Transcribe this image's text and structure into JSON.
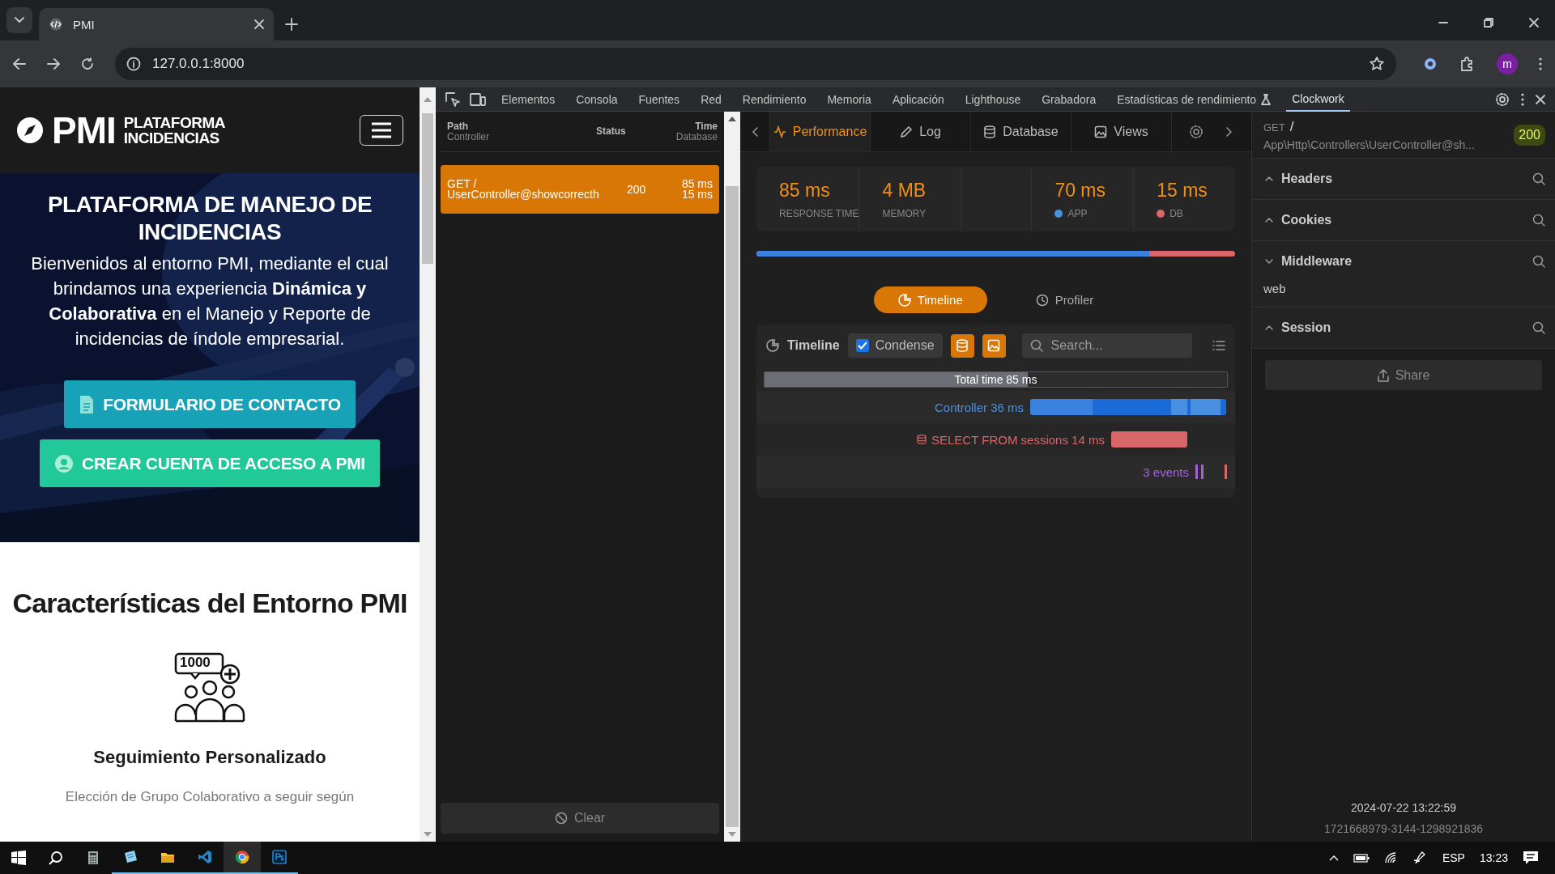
{
  "browser": {
    "tab_title": "PMI",
    "address": "127.0.0.1:8000",
    "profile_initial": "m"
  },
  "page": {
    "logo_mark": "PMI",
    "logo_lines": [
      "PLATAFORMA",
      "INCIDENCIAS"
    ],
    "hero_title": "PLATAFORMA DE MANEJO DE INCIDENCIAS",
    "hero_text": "Bienvenidos al entorno PMI, mediante el cual brindamos una experiencia **Dinámica y Colaborativa** en el Manejo y Reporte de incidencias de índole empresarial.",
    "buttons": [
      {
        "label": "FORMULARIO DE CONTACTO",
        "kind": "contact"
      },
      {
        "label": "CREAR CUENTA DE ACCESO A PMI",
        "kind": "account"
      }
    ],
    "section_title": "Características del Entorno PMI",
    "feature": {
      "badge": "1000",
      "title": "Seguimiento Personalizado",
      "text": "Elección de Grupo Colaborativo a seguir según"
    }
  },
  "devtools": {
    "tabs": [
      {
        "label": "Elementos",
        "selected": false
      },
      {
        "label": "Consola",
        "selected": false
      },
      {
        "label": "Fuentes",
        "selected": false
      },
      {
        "label": "Red",
        "selected": false
      },
      {
        "label": "Rendimiento",
        "selected": false
      },
      {
        "label": "Memoria",
        "selected": false
      },
      {
        "label": "Aplicación",
        "selected": false
      },
      {
        "label": "Lighthouse",
        "selected": false
      },
      {
        "label": "Grabadora",
        "selected": false
      },
      {
        "label": "Estadísticas de rendimiento",
        "selected": false
      },
      {
        "label": "Clockwork",
        "selected": true
      }
    ]
  },
  "requests": {
    "columns": [
      {
        "label": "Path",
        "sub": "Controller"
      },
      {
        "label": "Status"
      },
      {
        "label": "Time",
        "sub": "Database"
      }
    ],
    "rows": [
      {
        "path": "GET /",
        "controller": "UserController@showcorrecth",
        "status": "200",
        "time": "85 ms",
        "database": "15 ms",
        "selected": true
      }
    ],
    "clear": "Clear"
  },
  "panel": {
    "tabs": [
      {
        "label": "Performance",
        "kind": "performance",
        "selected": true
      },
      {
        "label": "Log",
        "kind": "log",
        "selected": false
      },
      {
        "label": "Database",
        "kind": "database",
        "selected": false
      },
      {
        "label": "Views",
        "kind": "views",
        "selected": false
      }
    ],
    "metrics": [
      {
        "value": "85 ms",
        "label": "RESPONSE TIME"
      },
      {
        "value": "4 MB",
        "label": "MEMORY"
      },
      {
        "kind": "empty"
      },
      {
        "value": "70 ms",
        "label": "APP",
        "color": "#4a90e2"
      },
      {
        "value": "15 ms",
        "label": "DB",
        "color": "#d9676a"
      }
    ],
    "app_share": {
      "level": 0.82
    },
    "views": [
      {
        "label": "Timeline",
        "selected": true
      },
      {
        "label": "Profiler",
        "selected": false
      }
    ],
    "timeline": {
      "title": "Timeline",
      "condense": {
        "label": "Condense",
        "checked": true
      },
      "search_placeholder": "Search...",
      "total": {
        "label": "Total time 85 ms",
        "level": 0.57
      },
      "rows": [
        {
          "kind": "controller",
          "label": "Controller 36 ms"
        },
        {
          "kind": "query",
          "label": "SELECT FROM sessions 14 ms"
        },
        {
          "kind": "events",
          "label": "3 events"
        }
      ]
    }
  },
  "details": {
    "method": "GET",
    "path": "/",
    "controller": "App\\Http\\Controllers\\UserController@sh...",
    "status": "200",
    "sections": [
      {
        "title": "Headers",
        "expanded": false
      },
      {
        "title": "Cookies",
        "expanded": false
      },
      {
        "title": "Middleware",
        "expanded": true,
        "items": [
          "web"
        ]
      },
      {
        "title": "Session",
        "expanded": false
      }
    ],
    "share": "Share",
    "timestamp": "2024-07-22 13:22:59",
    "id": "1721668979-3144-1298921836"
  },
  "taskbar": {
    "apps": [
      {
        "kind": "calculator",
        "running": false
      },
      {
        "kind": "notepad",
        "running": true
      },
      {
        "kind": "folder",
        "running": true
      },
      {
        "kind": "code",
        "running": true
      },
      {
        "kind": "chrome",
        "running": true
      },
      {
        "kind": "ps",
        "running": true
      }
    ],
    "language": "ESP",
    "time": "13:23"
  }
}
